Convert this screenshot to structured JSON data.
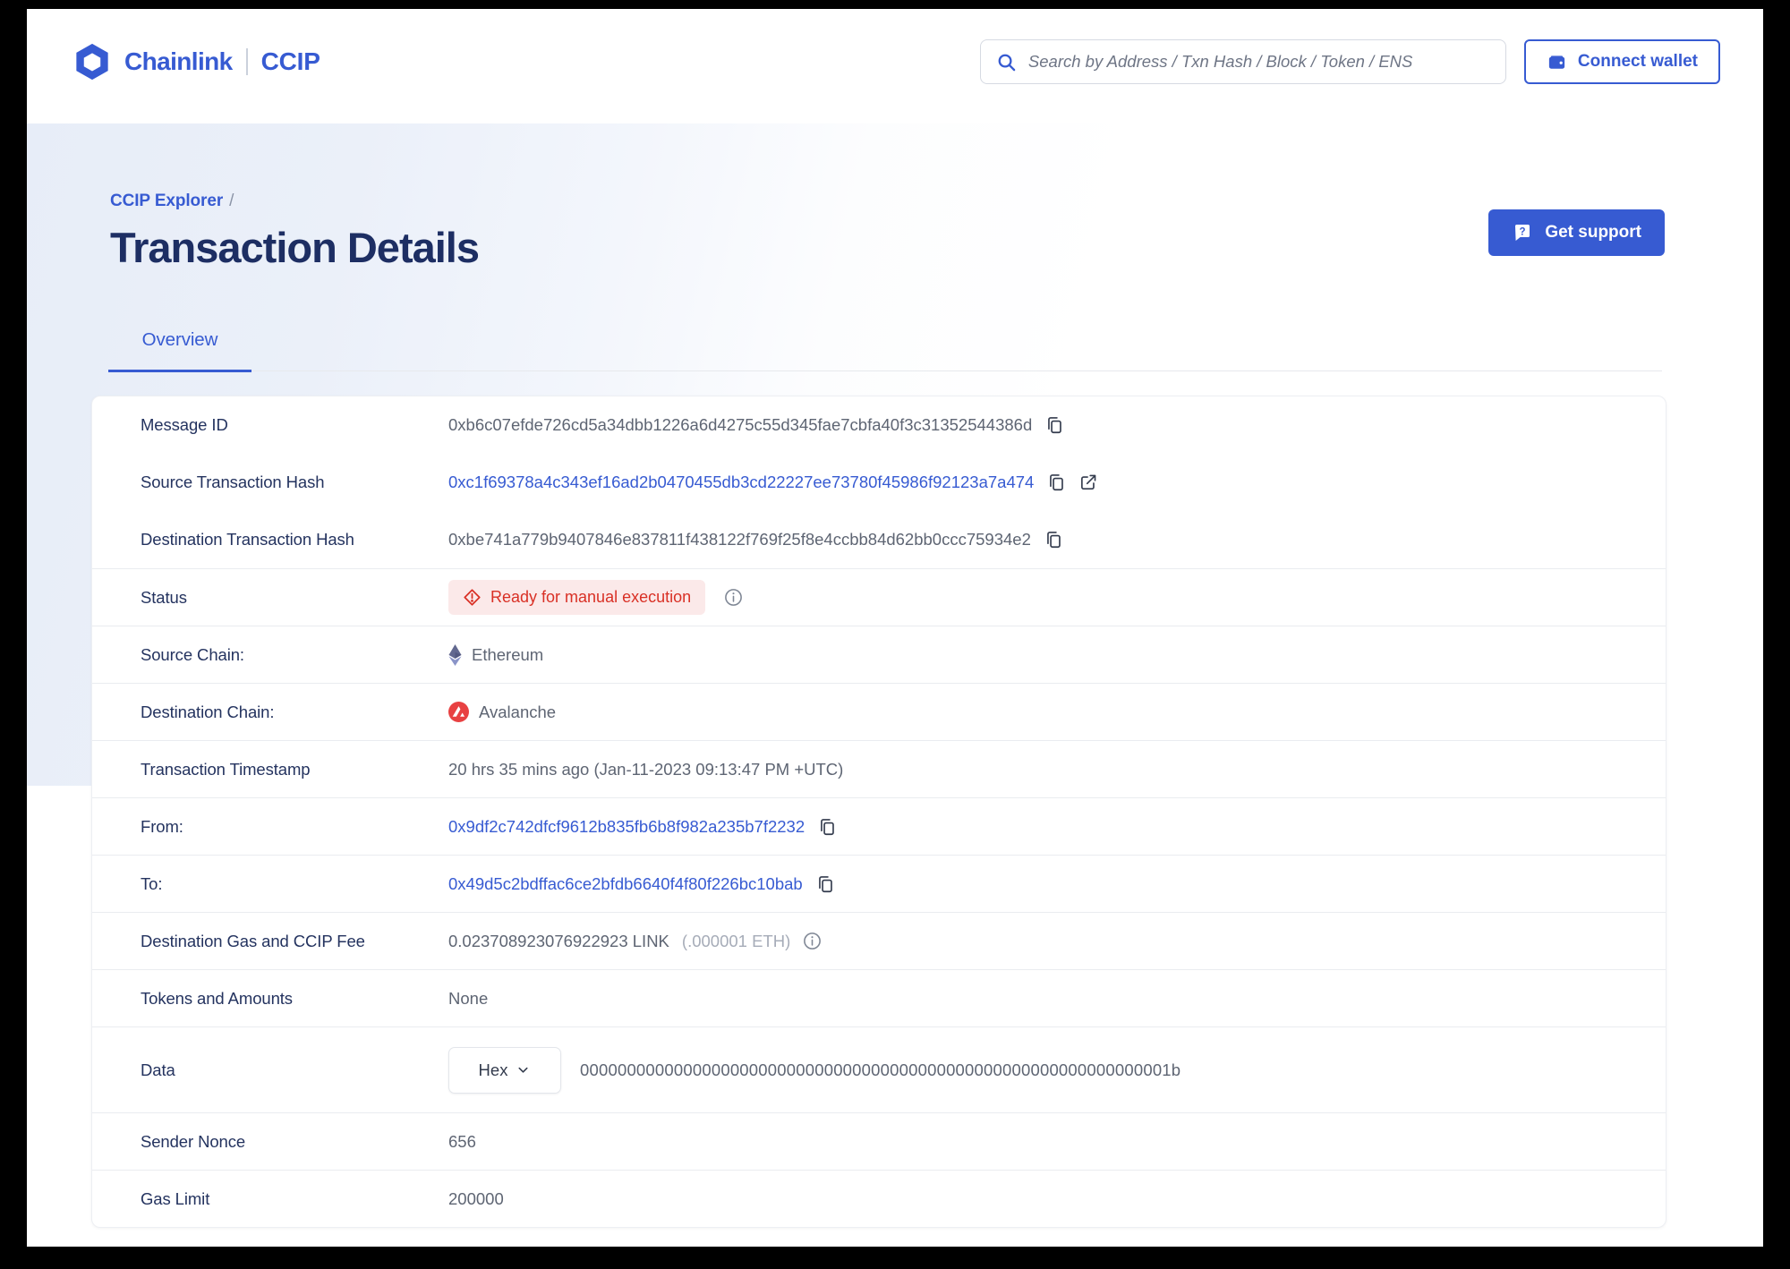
{
  "header": {
    "brand": {
      "name": "Chainlink",
      "product": "CCIP",
      "logo_icon": "chainlink-hexagon-icon"
    },
    "search": {
      "placeholder": "Search by Address / Txn Hash / Block / Token / ENS",
      "icon": "search-icon"
    },
    "connect_wallet": {
      "label": "Connect wallet",
      "icon": "wallet-icon"
    }
  },
  "breadcrumb": {
    "parent": "CCIP Explorer",
    "separator": "/"
  },
  "page": {
    "title": "Transaction Details"
  },
  "support_button": {
    "label": "Get support",
    "icon": "question-chat-icon"
  },
  "tabs": [
    {
      "label": "Overview",
      "active": true
    }
  ],
  "transaction": {
    "rows": [
      {
        "label": "Message ID",
        "type": "hash",
        "value": "0xb6c07efde726cd5a34dbb1226a6d4275c55d345fae7cbfa40f3c31352544386d",
        "link": false,
        "icons": [
          "copy-icon"
        ],
        "divider": false
      },
      {
        "label": "Source Transaction Hash",
        "type": "hash",
        "value": "0xc1f69378a4c343ef16ad2b0470455db3cd22227ee73780f45986f92123a7a474",
        "link": true,
        "icons": [
          "copy-icon",
          "external-link-icon"
        ],
        "divider": false
      },
      {
        "label": "Destination Transaction Hash",
        "type": "hash",
        "value": "0xbe741a779b9407846e837811f438122f769f25f8e4ccbb84d62bb0ccc75934e2",
        "link": false,
        "icons": [
          "copy-icon"
        ],
        "divider": false
      },
      {
        "label": "Status",
        "type": "status",
        "value": "Ready for manual execution",
        "status_icon": "alert-diamond-icon",
        "info": true,
        "divider": true
      },
      {
        "label": "Source Chain:",
        "type": "chain",
        "value": "Ethereum",
        "chain_icon": "ethereum-icon",
        "divider": true
      },
      {
        "label": "Destination Chain:",
        "type": "chain",
        "value": "Avalanche",
        "chain_icon": "avalanche-icon",
        "divider": true
      },
      {
        "label": "Transaction Timestamp",
        "type": "text",
        "value": "20 hrs 35 mins ago (Jan-11-2023 09:13:47 PM +UTC)",
        "divider": true
      },
      {
        "label": "From:",
        "type": "hash",
        "value": "0x9df2c742dfcf9612b835fb6b8f982a235b7f2232",
        "link": true,
        "icons": [
          "copy-icon"
        ],
        "divider": true
      },
      {
        "label": "To:",
        "type": "hash",
        "value": "0x49d5c2bdffac6ce2bfdb6640f4f80f226bc10bab",
        "link": true,
        "icons": [
          "copy-icon"
        ],
        "divider": true
      },
      {
        "label": "Destination Gas and CCIP Fee",
        "type": "fee",
        "value": "0.023708923076922923 LINK",
        "secondary": "(.000001 ETH)",
        "info": true,
        "divider": true
      },
      {
        "label": "Tokens and Amounts",
        "type": "text",
        "value": "None",
        "divider": true
      },
      {
        "label": "Data",
        "type": "hex",
        "format_selected": "Hex",
        "format_icon": "chevron-down-icon",
        "value": "000000000000000000000000000000000000000000000000000000000000001b",
        "divider": true
      },
      {
        "label": "Sender Nonce",
        "type": "text",
        "value": "656",
        "divider": true
      },
      {
        "label": "Gas Limit",
        "type": "text",
        "value": "200000",
        "divider": true
      }
    ]
  },
  "colors": {
    "brand_blue": "#375BD2",
    "heading_navy": "#1D2E63",
    "label_navy": "#24335F",
    "value_gray": "#5E6573",
    "status_red": "#D93025",
    "status_badge_bg": "#FBE9E9",
    "avalanche_red": "#E84142",
    "divider_gray": "#EAECF0"
  }
}
